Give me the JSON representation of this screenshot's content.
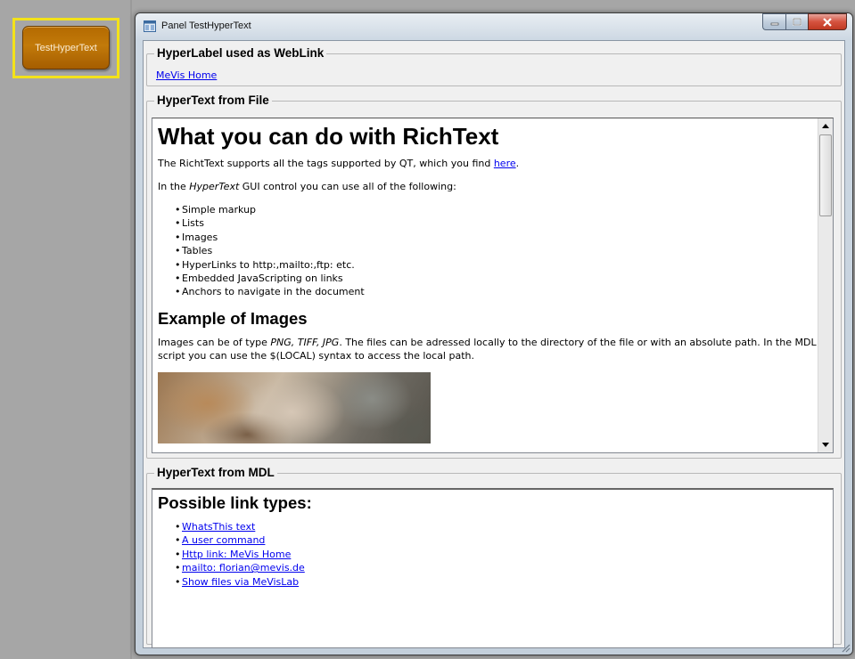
{
  "module_node": {
    "label": "TestHyperText"
  },
  "window": {
    "title": "Panel TestHyperText",
    "controls": {
      "minimize": "minimize-icon",
      "maximize": "maximize-icon",
      "close": "close-icon"
    }
  },
  "weblink_group": {
    "title": "HyperLabel used as WebLink",
    "link": "MeVis Home"
  },
  "file_group": {
    "title": "HyperText from File",
    "heading": "What you can do with RichText",
    "intro_before": "The RichtText supports all the tags supported by QT, which you find ",
    "intro_link": "here",
    "intro_after": ".",
    "para2_before": "In the ",
    "para2_em": "HyperText",
    "para2_after": " GUI control you can use all of the following:",
    "features": [
      "Simple markup",
      "Lists",
      "Images",
      "Tables",
      "HyperLinks to http:,mailto:,ftp: etc.",
      "Embedded JavaScripting on links",
      "Anchors to navigate in the document"
    ],
    "images_heading": "Example of Images",
    "images_before": "Images can be of type ",
    "images_types": "PNG, TIFF, JPG",
    "images_after": ". The files can be adressed locally to the directory of the file or with an absolute path. In the MDL script you can use the $(LOCAL) syntax to access the local path.",
    "scroll_up_icon": "scroll-up-arrow-icon",
    "scroll_down_icon": "scroll-down-arrow-icon"
  },
  "mdl_group": {
    "title": "HyperText from MDL",
    "heading": "Possible link types:",
    "links": [
      "WhatsThis text",
      "A user command",
      "Http link: MeVis Home",
      "mailto: florian@mevis.de",
      "Show files via MeVisLab"
    ]
  }
}
